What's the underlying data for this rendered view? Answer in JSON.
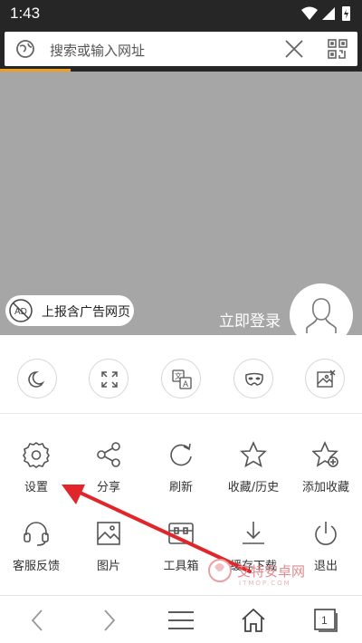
{
  "status_bar": {
    "time": "1:43"
  },
  "address_bar": {
    "placeholder": "搜索或输入网址"
  },
  "web_content": {
    "report_ad_label": "上报含广告网页",
    "login_label": "立即登录"
  },
  "quick_toggles": [
    {
      "name": "night-mode",
      "icon": "moon-icon"
    },
    {
      "name": "fullscreen",
      "icon": "fullscreen-icon"
    },
    {
      "name": "translate",
      "icon": "translate-icon"
    },
    {
      "name": "incognito",
      "icon": "mask-icon"
    },
    {
      "name": "no-image",
      "icon": "no-image-icon"
    }
  ],
  "menu": {
    "settings": "设置",
    "share": "分享",
    "refresh": "刷新",
    "bookmarks_history": "收藏/历史",
    "add_bookmark": "添加收藏",
    "feedback": "客服反馈",
    "images": "图片",
    "toolbox": "工具箱",
    "downloads": "缓存下载",
    "exit": "退出"
  },
  "bottom_nav": {
    "tabs_count": "1"
  },
  "watermark": {
    "text": "艾特安卓网",
    "sub": "ITMOP.COM"
  },
  "colors": {
    "accent": "#f0a020",
    "annotation_arrow": "#e0262b",
    "web_area": "#a6a6a6"
  }
}
